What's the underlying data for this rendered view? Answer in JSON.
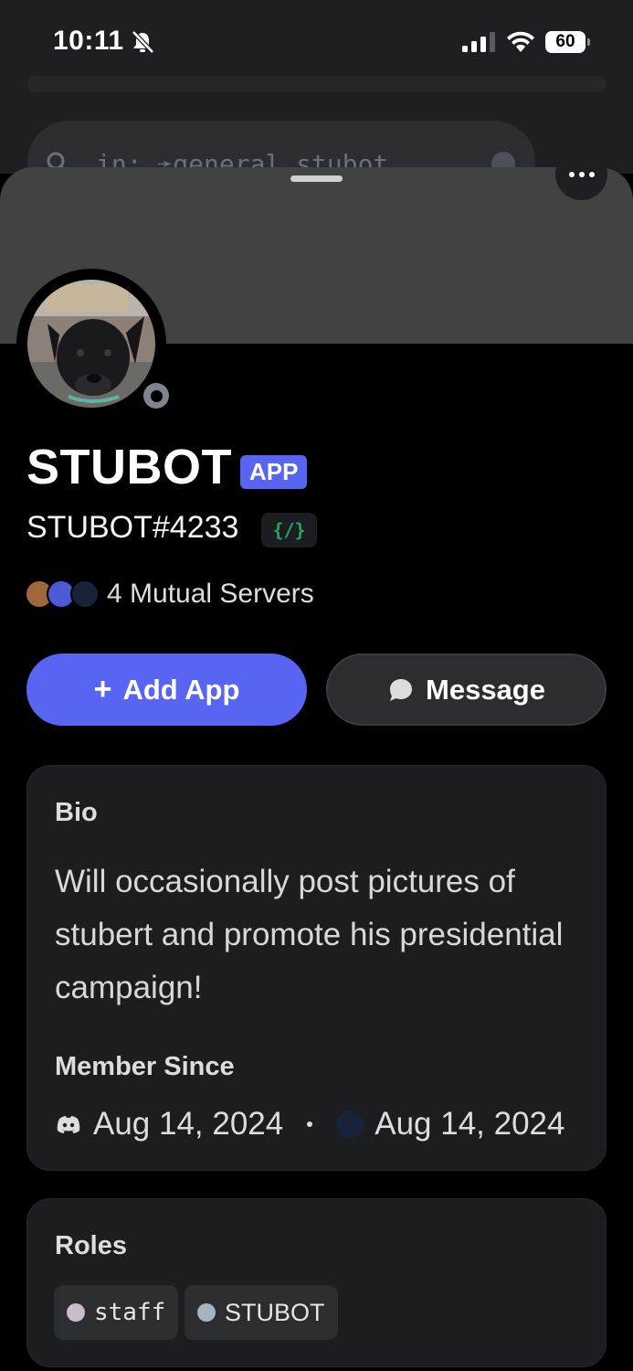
{
  "status_bar": {
    "time": "10:11",
    "battery": "60"
  },
  "background": {
    "search_query": "in: ➛general  stubot"
  },
  "profile": {
    "display_name": "STUBOT",
    "app_badge": "APP",
    "username": "STUBOT#4233",
    "dev_badge": "{/}",
    "mutual_servers": "4 Mutual Servers",
    "add_app_label": "Add App",
    "message_label": "Message"
  },
  "bio": {
    "heading": "Bio",
    "text": "Will occasionally post pictures of stubert and promote his presidential campaign!",
    "member_since_heading": "Member Since",
    "discord_date": "Aug 14, 2024",
    "server_date": "Aug 14, 2024"
  },
  "roles": {
    "heading": "Roles",
    "items": [
      {
        "name": "staff",
        "color": "#c9bccb"
      },
      {
        "name": "STUBOT",
        "color": "#a5b4bf"
      }
    ]
  },
  "colors": {
    "accent": "#5865f2",
    "status_offline": "#80848e",
    "dev_green": "#23a55a"
  }
}
